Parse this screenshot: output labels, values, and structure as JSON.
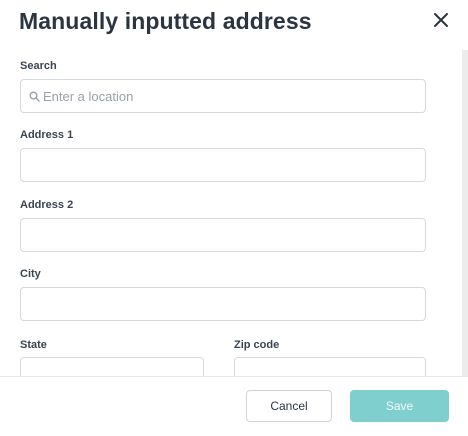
{
  "dialog": {
    "title": "Manually inputted address",
    "close_icon": "close-icon"
  },
  "form": {
    "search": {
      "label": "Search",
      "placeholder": "Enter a location",
      "value": "",
      "icon": "search-icon"
    },
    "address1": {
      "label": "Address 1",
      "value": ""
    },
    "address2": {
      "label": "Address 2",
      "value": ""
    },
    "city": {
      "label": "City",
      "value": ""
    },
    "state": {
      "label": "State",
      "value": ""
    },
    "zip": {
      "label": "Zip code",
      "value": ""
    }
  },
  "footer": {
    "cancel_label": "Cancel",
    "save_label": "Save"
  },
  "colors": {
    "accent": "#7fcfcf",
    "title": "#2b3542",
    "border": "#d6d9de"
  }
}
